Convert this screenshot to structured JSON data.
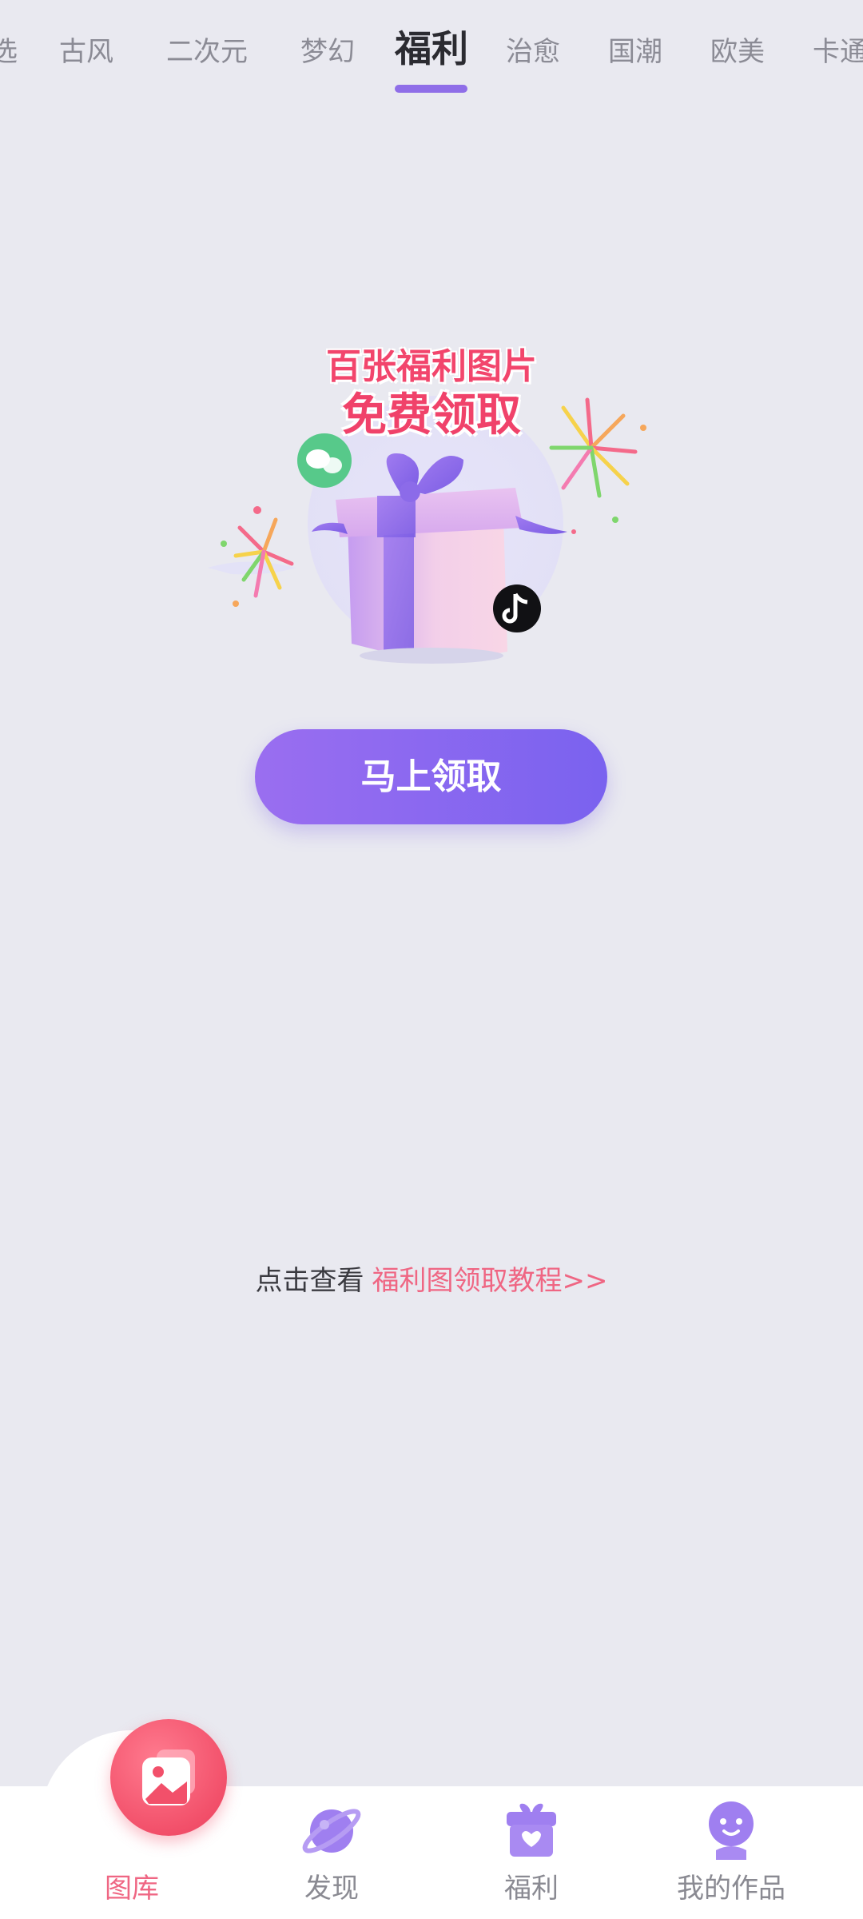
{
  "tabs": [
    {
      "label": "选"
    },
    {
      "label": "古风"
    },
    {
      "label": "二次元"
    },
    {
      "label": "梦幻"
    },
    {
      "label": "福利",
      "active": true
    },
    {
      "label": "治愈"
    },
    {
      "label": "国潮"
    },
    {
      "label": "欧美"
    },
    {
      "label": "卡通"
    }
  ],
  "hero": {
    "title_line1": "百张福利图片",
    "title_line2": "免费领取"
  },
  "cta": {
    "label": "马上领取"
  },
  "tutorial": {
    "prefix": "点击查看",
    "link": "福利图领取教程>>"
  },
  "bottom_nav": [
    {
      "label": "图库",
      "icon": "gallery-icon",
      "active": true
    },
    {
      "label": "发现",
      "icon": "planet-icon"
    },
    {
      "label": "福利",
      "icon": "gift-box-icon"
    },
    {
      "label": "我的作品",
      "icon": "profile-character-icon"
    }
  ],
  "colors": {
    "accent_purple": "#8f6ee8",
    "accent_pink": "#ef6683",
    "background": "#e9e9f0"
  }
}
